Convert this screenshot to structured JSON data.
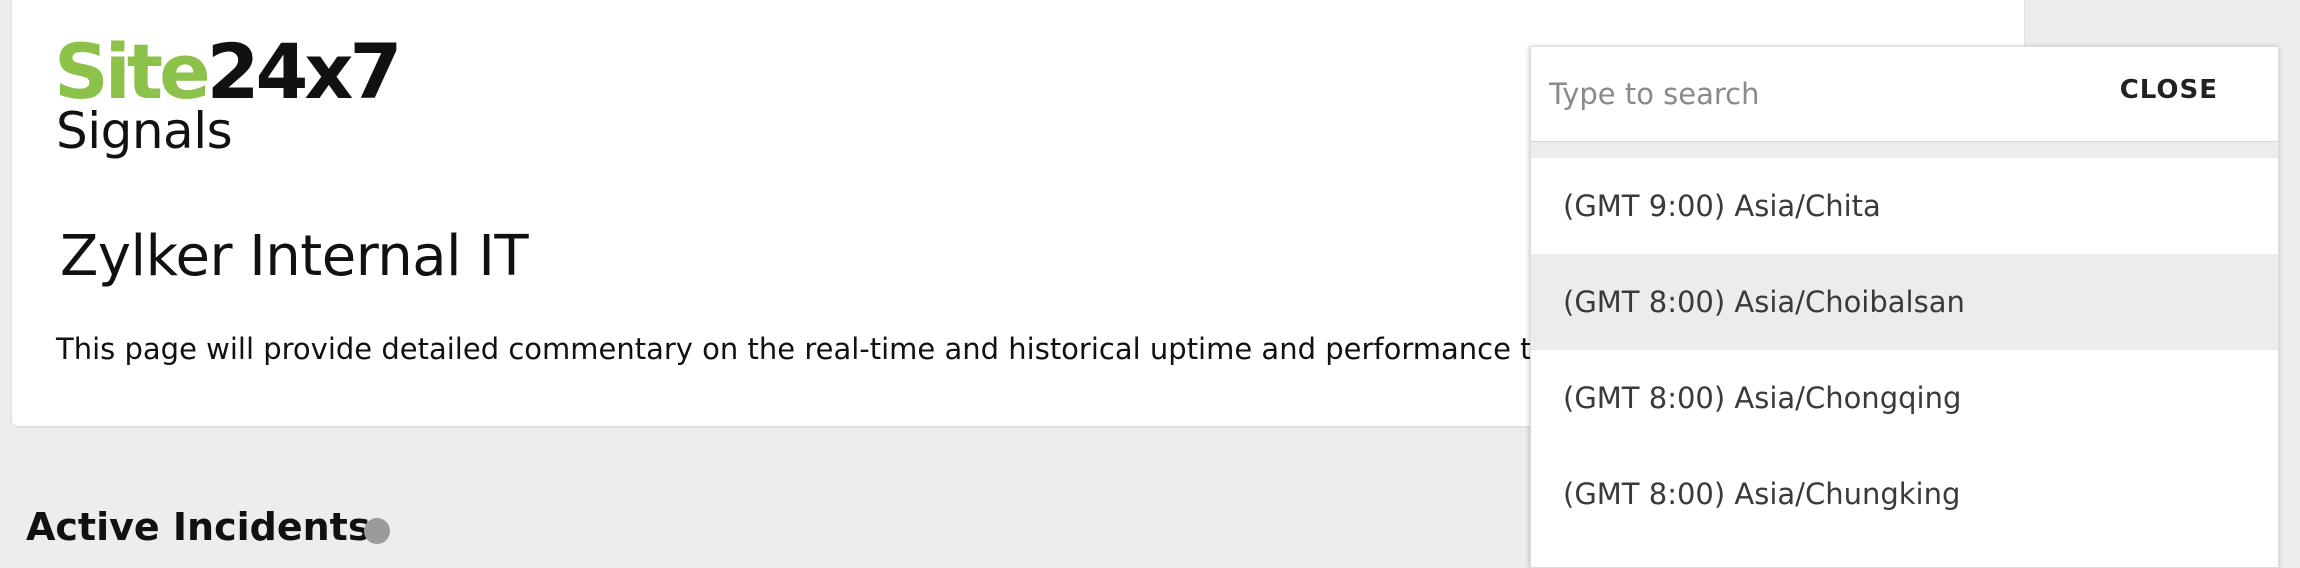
{
  "brand": {
    "logo_site": "Site",
    "logo_247": "24x7",
    "logo_signals": "Signals",
    "colors": {
      "site_green": "#8cc24a",
      "dark": "#111111"
    }
  },
  "header": {
    "title": "Zylker Internal IT",
    "description": "This page will provide detailed commentary on the real-time and historical uptime and performance trends"
  },
  "section": {
    "title": "Active Incidents",
    "info_icon": "info-icon"
  },
  "timezone_picker": {
    "search_placeholder": "Type to search",
    "search_value": "",
    "close_label": "CLOSE",
    "selected_index": 1,
    "items": [
      {
        "label": "(GMT 9:00) Asia/Chita"
      },
      {
        "label": "(GMT 8:00) Asia/Choibalsan"
      },
      {
        "label": "(GMT 8:00) Asia/Chongqing"
      },
      {
        "label": "(GMT 8:00) Asia/Chungking"
      }
    ]
  }
}
